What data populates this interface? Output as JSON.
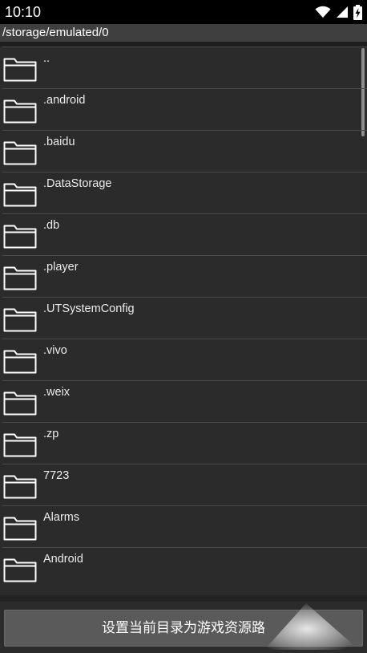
{
  "status_bar": {
    "time": "10:10",
    "icons": [
      "wifi-icon",
      "signal-icon",
      "battery-charging-icon"
    ]
  },
  "path_bar": {
    "path": "/storage/emulated/0"
  },
  "file_list": {
    "items": [
      {
        "name": "..",
        "icon": "folder-icon"
      },
      {
        "name": ".android",
        "icon": "folder-icon"
      },
      {
        "name": ".baidu",
        "icon": "folder-icon"
      },
      {
        "name": ".DataStorage",
        "icon": "folder-icon"
      },
      {
        "name": ".db",
        "icon": "folder-icon"
      },
      {
        "name": ".player",
        "icon": "folder-icon"
      },
      {
        "name": ".UTSystemConfig",
        "icon": "folder-icon"
      },
      {
        "name": ".vivo",
        "icon": "folder-icon"
      },
      {
        "name": ".weix",
        "icon": "folder-icon"
      },
      {
        "name": ".zp",
        "icon": "folder-icon"
      },
      {
        "name": "7723",
        "icon": "folder-icon"
      },
      {
        "name": "Alarms",
        "icon": "folder-icon"
      },
      {
        "name": "Android",
        "icon": "folder-icon"
      }
    ]
  },
  "bottom": {
    "button_label": "设置当前目录为游戏资源路"
  },
  "colors": {
    "background": "#2b2b2b",
    "path_bar": "#3f3f3f",
    "button": "#5a5a5a",
    "text": "#ececec"
  }
}
